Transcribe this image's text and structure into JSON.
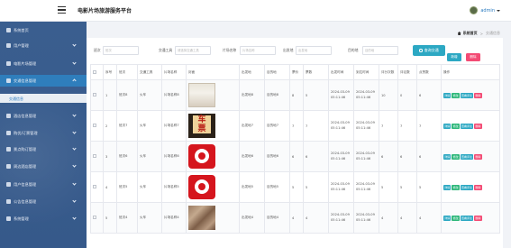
{
  "header": {
    "title": "电影片场旅游服务平台",
    "user": "admin"
  },
  "sidebar": {
    "items": [
      {
        "label": "系统首页",
        "icon": "home-icon"
      },
      {
        "label": "用户管理",
        "icon": "users-icon"
      },
      {
        "label": "电影片场管理",
        "icon": "film-icon"
      },
      {
        "label": "交通信息管理",
        "icon": "transport-icon",
        "active": true
      },
      {
        "label": "酒店信息管理",
        "icon": "hotel-icon"
      },
      {
        "label": "购优/订票管理",
        "icon": "ticket-icon"
      },
      {
        "label": "景点购订管理",
        "icon": "scenic-icon"
      },
      {
        "label": "周边酒店管理",
        "icon": "building-icon"
      },
      {
        "label": "用户信息管理",
        "icon": "user-info-icon"
      },
      {
        "label": "公告信息管理",
        "icon": "notice-icon"
      },
      {
        "label": "系统管理",
        "icon": "settings-icon"
      }
    ],
    "sub_item": "交通信息"
  },
  "breadcrumb": {
    "home": "系统首页",
    "current": "交通信息"
  },
  "search": {
    "fields": [
      {
        "label": "班次",
        "placeholder": "班次"
      },
      {
        "label": "交通工具",
        "placeholder": "请选择交通工具"
      },
      {
        "label": "片场名称",
        "placeholder": "片场名称"
      },
      {
        "label": "出发地",
        "placeholder": "出发地"
      },
      {
        "label": "目的地",
        "placeholder": "目的地"
      }
    ],
    "button": "查询交通"
  },
  "actions": {
    "add": "新增",
    "delete": "删除"
  },
  "table": {
    "headers": [
      "",
      "序号",
      "班次",
      "交通工具",
      "片场名称",
      "封面",
      "出发地",
      "目的地",
      "票价",
      "票数",
      "出发时间",
      "到达时间",
      "评分次数",
      "评论数",
      "点赞数",
      "操作"
    ],
    "rows": [
      {
        "index": "1",
        "banci": "班次8",
        "tool": "火车",
        "venue": "片场名称8",
        "cover": "a",
        "from": "出发地8",
        "to": "目的地8",
        "price": "8",
        "tickets": "5",
        "depart": "2024-03-09 05:11:46",
        "arrive": "2024-03-09 05:11:46",
        "rating": "10",
        "comments": "0",
        "likes": "6"
      },
      {
        "index": "2",
        "banci": "班次7",
        "tool": "火车",
        "venue": "片场名称7",
        "cover": "b",
        "from": "出发地7",
        "to": "目的地7",
        "price": "7",
        "tickets": "7",
        "depart": "2024-03-09 05:11:46",
        "arrive": "2024-03-09 05:11:46",
        "rating": "7",
        "comments": "7",
        "likes": "7"
      },
      {
        "index": "3",
        "banci": "班次6",
        "tool": "火车",
        "venue": "片场名称6",
        "cover": "c",
        "from": "出发地6",
        "to": "目的地6",
        "price": "6",
        "tickets": "6",
        "depart": "2024-03-09 05:11:46",
        "arrive": "2024-03-09 05:11:46",
        "rating": "6",
        "comments": "6",
        "likes": "6"
      },
      {
        "index": "4",
        "banci": "班次5",
        "tool": "火车",
        "venue": "片场名称5",
        "cover": "c",
        "from": "出发地5",
        "to": "目的地5",
        "price": "5",
        "tickets": "5",
        "depart": "2024-03-09 05:11:46",
        "arrive": "2024-03-09 05:11:46",
        "rating": "5",
        "comments": "5",
        "likes": "5"
      },
      {
        "index": "5",
        "banci": "班次4",
        "tool": "火车",
        "venue": "片场名称4",
        "cover": "d",
        "from": "出发地4",
        "to": "目的地4",
        "price": "4",
        "tickets": "4",
        "depart": "2024-03-09 05:11:46",
        "arrive": "2024-03-09 05:11:46",
        "rating": "4",
        "comments": "4",
        "likes": "4"
      }
    ],
    "ops": {
      "detail": "详情",
      "edit": "修改",
      "review": "查看评论",
      "delete": "删除"
    }
  },
  "colors": {
    "sidebar": "#36598a",
    "active": "#2f7ebc",
    "primary": "#2ca8c3",
    "success": "#2fb87b",
    "danger": "#f34b74"
  }
}
